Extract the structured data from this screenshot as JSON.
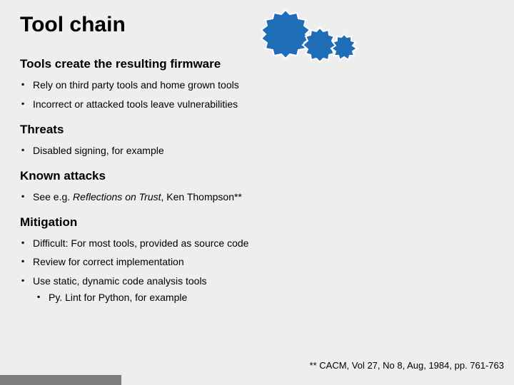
{
  "title": "Tool chain",
  "sections": [
    {
      "heading": "Tools create the resulting firmware",
      "bullets": [
        {
          "text": "Rely on third party tools and home grown tools"
        },
        {
          "text": "Incorrect or attacked tools leave vulnerabilities"
        }
      ]
    },
    {
      "heading": "Threats",
      "bullets": [
        {
          "text": "Disabled signing, for example"
        }
      ]
    },
    {
      "heading": "Known attacks",
      "bullets": [
        {
          "pre": "See e.g. ",
          "italic": "Reflections on Trust",
          "post": ", Ken Thompson**"
        }
      ]
    },
    {
      "heading": "Mitigation",
      "bullets": [
        {
          "text": "Difficult: For most tools, provided as source code"
        },
        {
          "text": "Review for correct implementation"
        },
        {
          "text": "Use static, dynamic code analysis tools",
          "sub": [
            {
              "text": "Py. Lint for Python, for example"
            }
          ]
        }
      ]
    }
  ],
  "footnote": "** CACM, Vol 27, No 8, Aug, 1984, pp. 761-763",
  "icons": {
    "gears": "gears-icon"
  }
}
